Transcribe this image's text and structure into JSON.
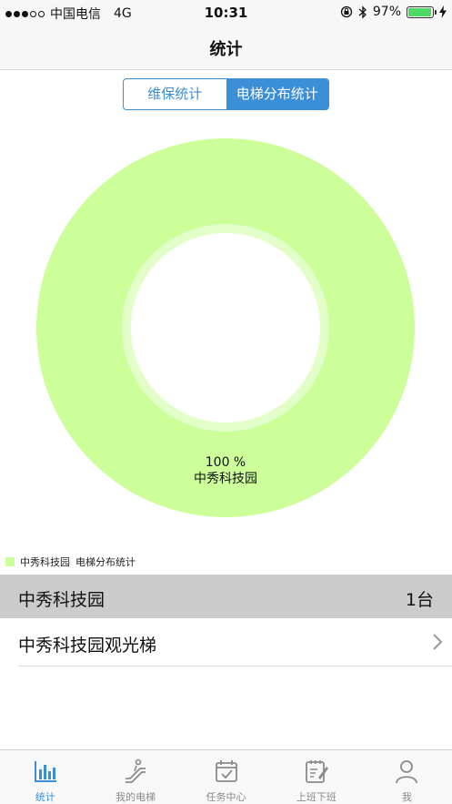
{
  "status_bar": {
    "carrier": "中国电信",
    "network": "4G",
    "time": "10:31",
    "battery": "97%",
    "battery_level": 0.97
  },
  "nav": {
    "title": "统计"
  },
  "segmented": {
    "items": [
      {
        "label": "维保统计",
        "active": false
      },
      {
        "label": "电梯分布统计",
        "active": true
      }
    ]
  },
  "chart_data": {
    "type": "pie",
    "categories": [
      "中秀科技园"
    ],
    "values": [
      100
    ],
    "slice_label": "100 %",
    "slice_name": "中秀科技园",
    "colors": [
      "#ccff99"
    ],
    "legend": {
      "label": "中秀科技园",
      "title": "电梯分布统计",
      "position": "bottom-left"
    }
  },
  "group": {
    "name": "中秀科技园",
    "count": "1台"
  },
  "list": [
    {
      "name": "中秀科技园观光梯"
    }
  ],
  "tabs": [
    {
      "label": "统计",
      "icon": "chart-icon",
      "active": true
    },
    {
      "label": "我的电梯",
      "icon": "escalator-icon",
      "active": false
    },
    {
      "label": "任务中心",
      "icon": "calendar-check-icon",
      "active": false
    },
    {
      "label": "上班下班",
      "icon": "clipboard-edit-icon",
      "active": false
    },
    {
      "label": "我",
      "icon": "person-icon",
      "active": false
    }
  ],
  "colors": {
    "accent": "#3a8fd6",
    "slice": "#ccff99",
    "battery": "#4cd964"
  }
}
